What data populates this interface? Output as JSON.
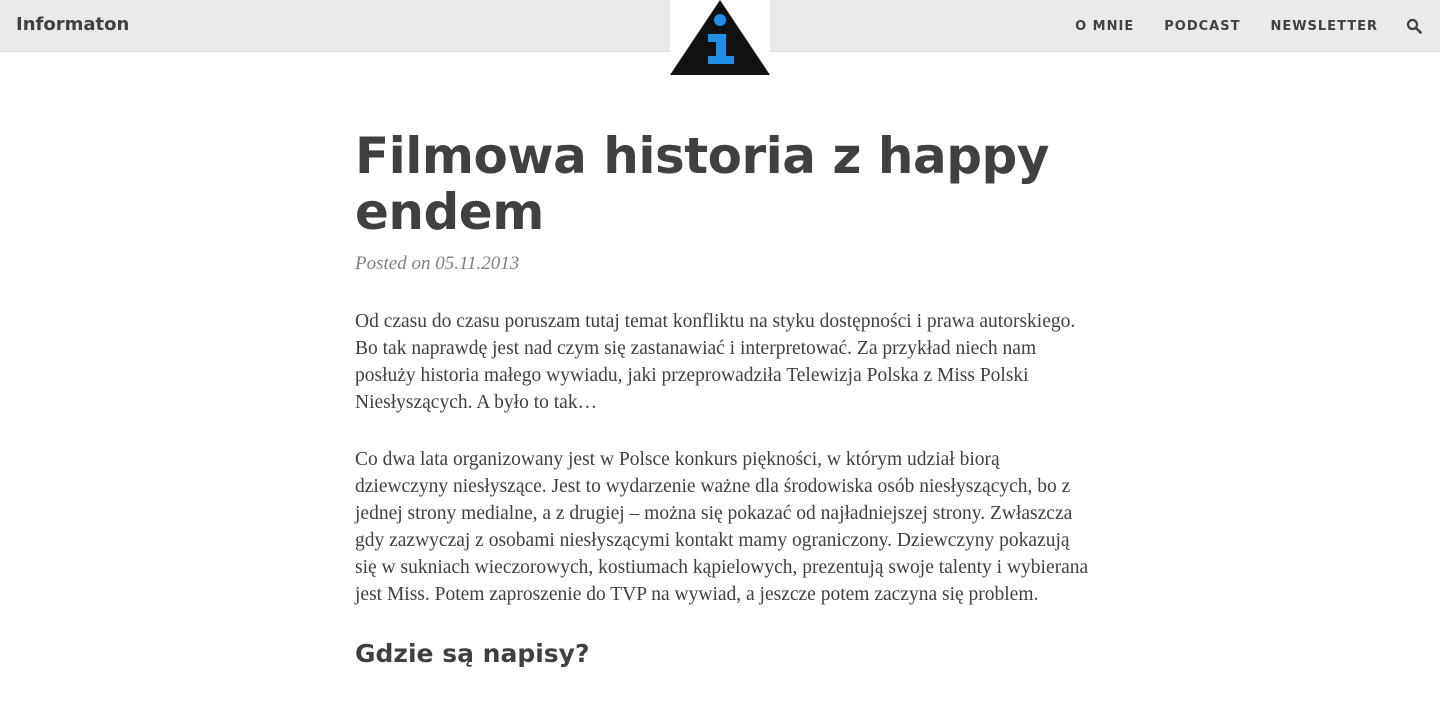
{
  "site": {
    "brand": "Informaton"
  },
  "nav": {
    "items": [
      {
        "label": "O MNIE"
      },
      {
        "label": "PODCAST"
      },
      {
        "label": "NEWSLETTER"
      }
    ],
    "search_icon": "search-icon"
  },
  "logo": {
    "triangle_color": "#111111",
    "glyph_color": "#1f8fe8"
  },
  "post": {
    "title": "Filmowa historia z happy endem",
    "meta": "Posted on 05.11.2013",
    "paragraphs": [
      "Od czasu do czasu poruszam tutaj temat konfliktu na styku dostępności i prawa autorskiego. Bo tak naprawdę jest nad czym się zastanawiać i interpretować. Za przykład niech nam posłuży historia małego wywiadu, jaki przeprowadziła Telewizja Polska z Miss Polski Niesłyszących. A było to tak…",
      "Co dwa lata organizowany jest w Polsce konkurs piękności, w którym udział biorą dziewczyny niesłyszące. Jest to wydarzenie ważne dla środowiska osób niesłyszących, bo z jednej strony medialne, a z drugiej – można się pokazać od najładniejszej strony. Zwłaszcza gdy zazwyczaj z osobami niesłyszącymi kontakt mamy ograniczony. Dziewczyny pokazują się w sukniach wieczorowych, kostiumach kąpielowych, prezentują swoje talenty i wybierana jest Miss. Potem zaproszenie do TVP na wywiad, a jeszcze potem zaczyna się problem."
    ],
    "subheading": "Gdzie są napisy?"
  }
}
